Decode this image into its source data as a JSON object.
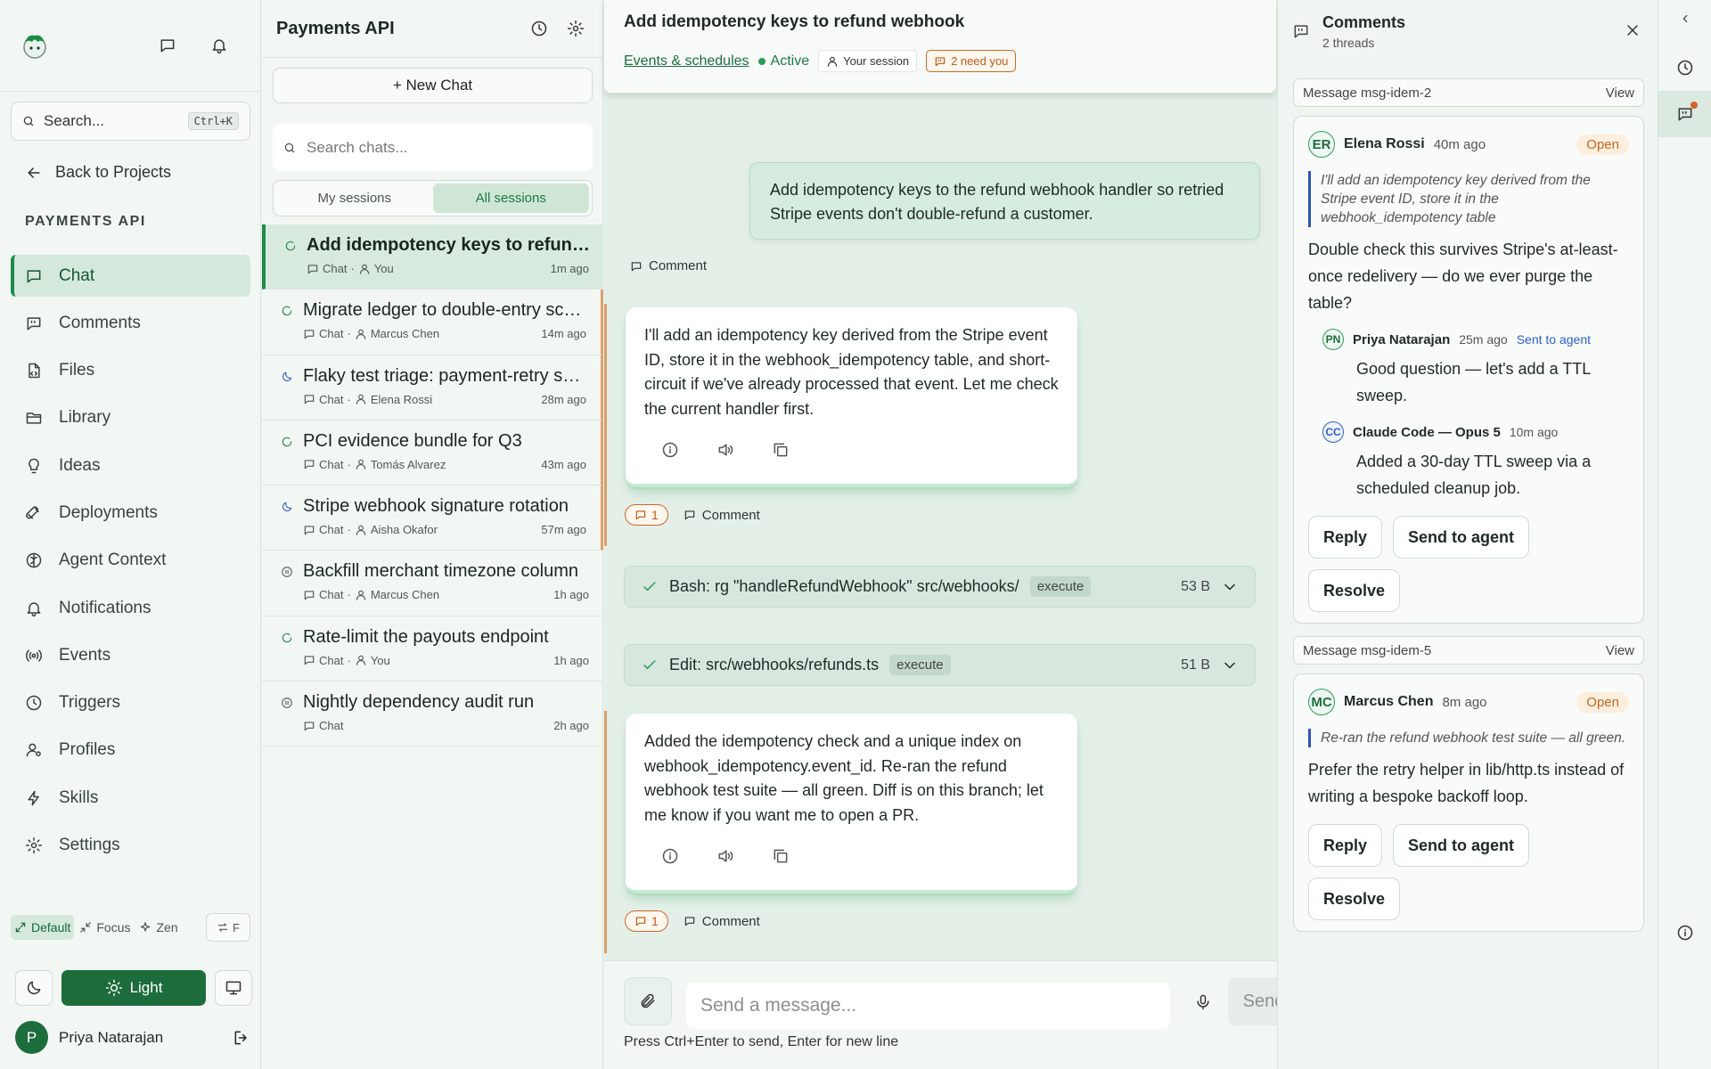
{
  "sidebar": {
    "search_placeholder": "Search...",
    "search_shortcut": "Ctrl+K",
    "back_label": "Back to Projects",
    "project_name": "PAYMENTS API",
    "nav": [
      {
        "label": "Chat",
        "icon": "chat-icon",
        "active": true
      },
      {
        "label": "Comments",
        "icon": "comments-icon"
      },
      {
        "label": "Files",
        "icon": "file-icon"
      },
      {
        "label": "Library",
        "icon": "folder-icon"
      },
      {
        "label": "Ideas",
        "icon": "lightbulb-icon"
      },
      {
        "label": "Deployments",
        "icon": "rocket-icon"
      },
      {
        "label": "Agent Context",
        "icon": "brain-icon"
      },
      {
        "label": "Notifications",
        "icon": "bell-icon"
      },
      {
        "label": "Events",
        "icon": "broadcast-icon"
      },
      {
        "label": "Triggers",
        "icon": "clock-icon"
      },
      {
        "label": "Profiles",
        "icon": "user-gear-icon"
      },
      {
        "label": "Skills",
        "icon": "lightning-icon"
      },
      {
        "label": "Settings",
        "icon": "gear-icon"
      }
    ],
    "modes": {
      "default": "Default",
      "focus": "Focus",
      "zen": "Zen",
      "swap": "F"
    },
    "theme_light": "Light",
    "user_initial": "P",
    "user_name": "Priya Natarajan",
    "accent": "#1d6c3c"
  },
  "chatlist": {
    "title": "Payments API",
    "new_chat": "+ New Chat",
    "search_placeholder": "Search chats...",
    "tabs": {
      "mine": "My sessions",
      "all": "All sessions"
    },
    "items": [
      {
        "title": "Add idempotency keys to refund webhook",
        "kind": "Chat",
        "user": "You",
        "time": "1m ago",
        "status": "running"
      },
      {
        "title": "Migrate ledger to double-entry schema",
        "kind": "Chat",
        "user": "Marcus Chen",
        "time": "14m ago",
        "status": "running"
      },
      {
        "title": "Flaky test triage: payment-retry suite",
        "kind": "Chat",
        "user": "Elena Rossi",
        "time": "28m ago",
        "status": "sleeping"
      },
      {
        "title": "PCI evidence bundle for Q3",
        "kind": "Chat",
        "user": "Tomás Alvarez",
        "time": "43m ago",
        "status": "running"
      },
      {
        "title": "Stripe webhook signature rotation",
        "kind": "Chat",
        "user": "Aisha Okafor",
        "time": "57m ago",
        "status": "sleeping"
      },
      {
        "title": "Backfill merchant timezone column",
        "kind": "Chat",
        "user": "Marcus Chen",
        "time": "1h ago",
        "status": "paused"
      },
      {
        "title": "Rate-limit the payouts endpoint",
        "kind": "Chat",
        "user": "You",
        "time": "1h ago",
        "status": "running"
      },
      {
        "title": "Nightly dependency audit run",
        "kind": "Chat",
        "user": "",
        "time": "2h ago",
        "status": "paused"
      }
    ]
  },
  "main": {
    "title": "Add idempotency keys to refund webhook",
    "link": "Events & schedules",
    "status": "Active",
    "session": "Your session",
    "need_you": "2 need you",
    "user_message": "Add idempotency keys to the refund webhook handler so retried Stripe events don't double-refund a customer.",
    "comment_label": "Comment",
    "assistant_1": "I'll add an idempotency key derived from the Stripe event ID, store it in the webhook_idempotency table, and short-circuit if we've already processed that event. Let me check the current handler first.",
    "assistant_1_count": "1",
    "tool_1": {
      "label": "Bash: rg \"handleRefundWebhook\" src/webhooks/",
      "tag": "execute",
      "size": "53 B"
    },
    "tool_2": {
      "label": "Edit: src/webhooks/refunds.ts",
      "tag": "execute",
      "size": "51 B"
    },
    "assistant_2": "Added the idempotency check and a unique index on webhook_idempotency.event_id. Re-ran the refund webhook test suite — all green. Diff is on this branch; let me know if you want me to open a PR.",
    "assistant_2_count": "1",
    "composer_placeholder": "Send a message...",
    "send": "Send",
    "hint": "Press Ctrl+Enter to send, Enter for new line"
  },
  "comments": {
    "title": "Comments",
    "subtitle": "2 threads",
    "view": "View",
    "threads": [
      {
        "message": "Message msg-idem-2",
        "initials": "ER",
        "author": "Elena Rossi",
        "time": "40m ago",
        "status": "Open",
        "quote": "I'll add an idempotency key derived from the Stripe event ID, store it in the webhook_idempotency table",
        "body": "Double check this survives Stripe's at-least-once redelivery — do we ever purge the table?",
        "replies": [
          {
            "initials": "PN",
            "author": "Priya Natarajan",
            "time": "25m ago",
            "note": "Sent to agent",
            "body": "Good question — let's add a TTL sweep."
          },
          {
            "initials": "CC",
            "author": "Claude Code — Opus 5",
            "time": "10m ago",
            "note": "",
            "body": "Added a 30-day TTL sweep via a scheduled cleanup job."
          }
        ]
      },
      {
        "message": "Message msg-idem-5",
        "initials": "MC",
        "author": "Marcus Chen",
        "time": "8m ago",
        "status": "Open",
        "quote": "Re-ran the refund webhook test suite — all green.",
        "body": "Prefer the retry helper in lib/http.ts instead of writing a bespoke backoff loop.",
        "replies": []
      }
    ],
    "reply": "Reply",
    "send_to_agent": "Send to agent",
    "resolve": "Resolve"
  }
}
